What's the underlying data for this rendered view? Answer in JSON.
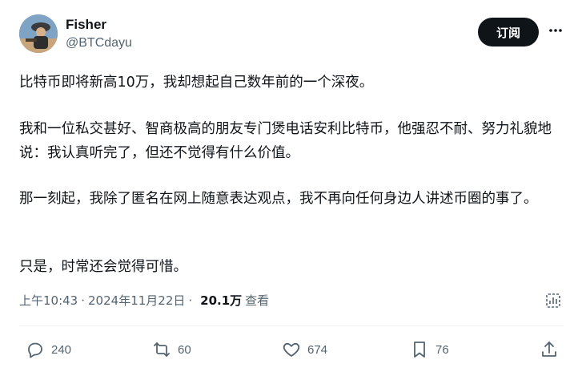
{
  "author": {
    "name": "Fisher",
    "handle": "@BTCdayu"
  },
  "header": {
    "subscribe_label": "订阅",
    "more_icon": "more-horizontal-icon"
  },
  "tweet": {
    "paragraphs": [
      "比特币即将新高10万，我却想起自己数年前的一个深夜。",
      "我和一位私交甚好、智商极高的朋友专门煲电话安利比特币，他强忍不耐、努力礼貌地说：我认真听完了，但还不觉得有什么价值。",
      "那一刻起，我除了匿名在网上随意表达观点，我不再向任何身边人讲述币圈的事了。",
      "只是，时常还会觉得可惜。"
    ]
  },
  "meta": {
    "time": "上午10:43",
    "separator": "·",
    "date": "2024年11月22日",
    "views_count": "20.1万",
    "views_label": "查看"
  },
  "actions": {
    "reply_count": "240",
    "retweet_count": "60",
    "like_count": "674",
    "bookmark_count": "76"
  },
  "colors": {
    "text_primary": "#0f1419",
    "text_secondary": "#536471",
    "button_bg": "#0f1419",
    "divider": "#eff3f4"
  }
}
